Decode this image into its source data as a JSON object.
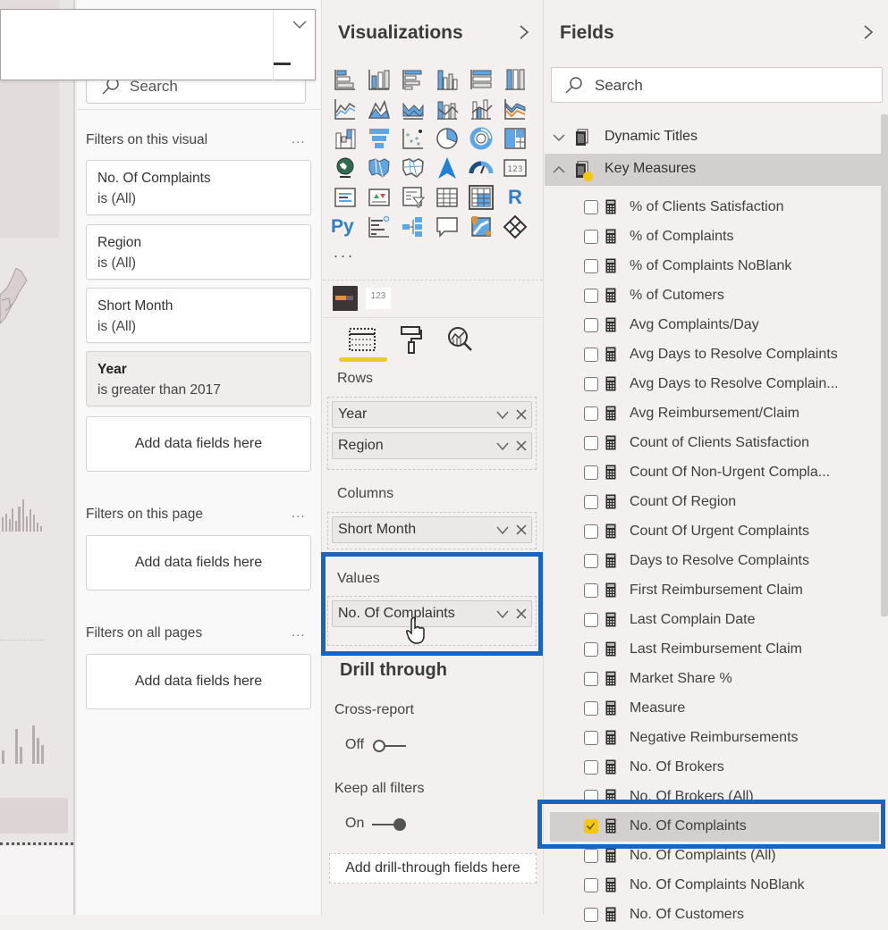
{
  "dropdown": {
    "icon_expand": "chevron-down-icon",
    "icon_collapse": "minus-icon"
  },
  "filters_pane": {
    "search_placeholder": "Search",
    "sections": {
      "visual": {
        "title": "Filters on this visual",
        "more": "...",
        "cards": [
          {
            "field": "No. Of Complaints",
            "condition": "is (All)"
          },
          {
            "field": "Region",
            "condition": "is (All)"
          },
          {
            "field": "Short Month",
            "condition": "is (All)"
          },
          {
            "field": "Year",
            "condition": "is greater than 2017",
            "active": true
          }
        ],
        "add_label": "Add data fields here"
      },
      "page": {
        "title": "Filters on this page",
        "more": "...",
        "add_label": "Add data fields here"
      },
      "all": {
        "title": "Filters on all pages",
        "more": "...",
        "add_label": "Add data fields here"
      }
    }
  },
  "visualizations": {
    "title": "Visualizations",
    "collapse_icon": "chevron-right-icon",
    "icons": [
      "stacked-bar-chart",
      "stacked-column-chart",
      "clustered-bar-chart",
      "clustered-column-chart",
      "100-stacked-bar-chart",
      "100-stacked-column-chart",
      "line-chart",
      "area-chart",
      "stacked-area-chart",
      "line-and-stacked-column-chart",
      "line-and-clustered-column-chart",
      "ribbon-chart",
      "waterfall-chart",
      "funnel",
      "scatter-chart",
      "pie-chart",
      "donut-chart",
      "treemap",
      "map",
      "filled-map",
      "shape-map",
      "azure-map",
      "gauge",
      "card",
      "multi-row-card",
      "kpi",
      "slicer",
      "table",
      "matrix",
      "r-script-visual",
      "python-visual",
      "key-influencers",
      "decomposition-tree",
      "qa",
      "arcgis-map",
      "power-apps"
    ],
    "r_label": "R",
    "py_label": "Py",
    "more_label": "...",
    "custom_visuals": [
      {
        "name": "custom-bar-visual"
      },
      {
        "name": "number-card-visual",
        "label": "123"
      }
    ],
    "tabs": [
      {
        "name": "fields-tab",
        "active": true
      },
      {
        "name": "format-tab"
      },
      {
        "name": "analytics-tab"
      }
    ],
    "wells": {
      "rows": {
        "label": "Rows",
        "items": [
          "Year",
          "Region"
        ]
      },
      "columns": {
        "label": "Columns",
        "items": [
          "Short Month"
        ]
      },
      "values": {
        "label": "Values",
        "items": [
          "No. Of Complaints"
        ]
      }
    },
    "drill_through": {
      "title": "Drill through",
      "cross_report": {
        "label": "Cross-report",
        "state": "Off"
      },
      "keep_filters": {
        "label": "Keep all filters",
        "state": "On"
      },
      "add_label": "Add drill-through fields here"
    }
  },
  "fields": {
    "title": "Fields",
    "collapse_icon": "chevron-right-icon",
    "search_placeholder": "Search",
    "tables": [
      {
        "name": "Dynamic Titles",
        "expanded": false
      },
      {
        "name": "Key Measures",
        "expanded": true
      }
    ],
    "measures": [
      {
        "name": "% of Clients Satisfaction",
        "checked": false
      },
      {
        "name": "% of Complaints",
        "checked": false
      },
      {
        "name": "% of Complaints NoBlank",
        "checked": false
      },
      {
        "name": "% of Cutomers",
        "checked": false
      },
      {
        "name": "Avg Complaints/Day",
        "checked": false
      },
      {
        "name": "Avg Days to Resolve Complaints",
        "checked": false
      },
      {
        "name": "Avg Days to Resolve Complain...",
        "checked": false
      },
      {
        "name": "Avg Reimbursement/Claim",
        "checked": false
      },
      {
        "name": "Count of Clients Satisfaction",
        "checked": false
      },
      {
        "name": "Count Of Non-Urgent Compla...",
        "checked": false
      },
      {
        "name": "Count Of Region",
        "checked": false
      },
      {
        "name": "Count Of Urgent Complaints",
        "checked": false
      },
      {
        "name": "Days to Resolve Complaints",
        "checked": false
      },
      {
        "name": "First Reimbursement Claim",
        "checked": false
      },
      {
        "name": "Last Complain Date",
        "checked": false
      },
      {
        "name": "Last Reimbursement Claim",
        "checked": false
      },
      {
        "name": "Market Share %",
        "checked": false
      },
      {
        "name": "Measure",
        "checked": false
      },
      {
        "name": "Negative Reimbursements",
        "checked": false
      },
      {
        "name": "No. Of Brokers",
        "checked": false
      },
      {
        "name": "No. Of Brokers (All)",
        "checked": false
      },
      {
        "name": "No. Of Complaints",
        "checked": true
      },
      {
        "name": "No. Of Complaints (All)",
        "checked": false
      },
      {
        "name": "No. Of Complaints NoBlank",
        "checked": false
      },
      {
        "name": "No. Of Customers",
        "checked": false
      }
    ]
  },
  "colors": {
    "highlight_border": "#1665c0",
    "accent_yellow": "#f2c811",
    "tab_underline": "#e9cc2e",
    "icon_blue": "#5ea7e6"
  }
}
